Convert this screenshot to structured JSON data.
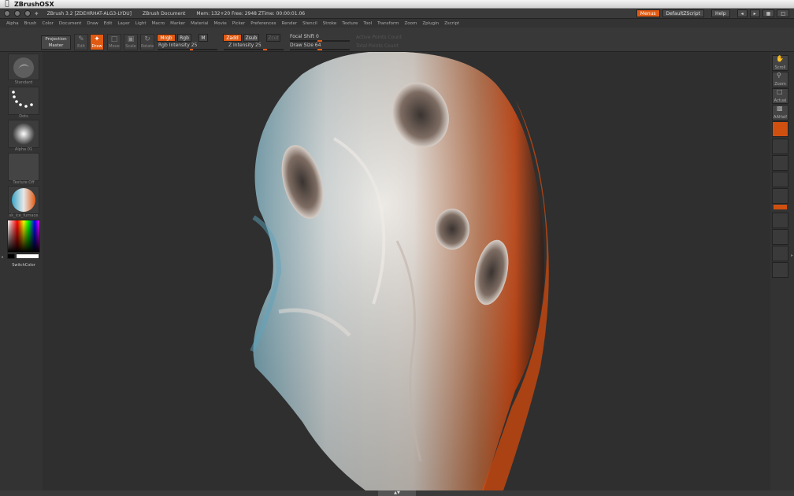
{
  "osx_menubar": {
    "app_name": "ZBrushOSX"
  },
  "titlebar": {
    "app_title": "ZBrush 3.2 [ZDEHRHAT-ALG3-LYDU]",
    "document": "ZBrush Document",
    "stats": "Mem: 132+20  Free: 2948  ZTime: 00:00:01.06",
    "menus_btn": "Menus",
    "script_btn": "DefaultZScript",
    "help_btn": "Help"
  },
  "menubar": {
    "items": [
      "Alpha",
      "Brush",
      "Color",
      "Document",
      "Draw",
      "Edit",
      "Layer",
      "Light",
      "Macro",
      "Marker",
      "Material",
      "Movie",
      "Picker",
      "Preferences",
      "Render",
      "Stencil",
      "Stroke",
      "Texture",
      "Tool",
      "Transform",
      "Zoom",
      "Zplugin",
      "Zscript"
    ]
  },
  "toolbar": {
    "projection_master": "Projection\nMaster",
    "edit": "Edit",
    "draw": "Draw",
    "move": "Move",
    "scale": "Scale",
    "rotate": "Rotate",
    "mrgb": "Mrgb",
    "rgb": "Rgb",
    "m": "M",
    "zadd": "Zadd",
    "zsub": "Zsub",
    "zcut": "Zcut",
    "rgb_intensity": "Rgb Intensity 25",
    "z_intensity": "Z Intensity 25",
    "focal_shift": "Focal Shift 0",
    "draw_size": "Draw Size 64",
    "active_points": "Active Points Count",
    "total_points": "Total Points Count"
  },
  "left_shelf": {
    "brush_label": "Standard",
    "stroke_label": "Dots",
    "alpha_label": "Alpha 01",
    "texture_label": "Texture Off",
    "material_label": "sk_ice_furnace",
    "switch_color": "SwitchColor"
  },
  "right_shelf": {
    "scroll": "Scroll",
    "zoom": "Zoom",
    "actual": "Actual",
    "aahalf": "AAHalf"
  },
  "colors": {
    "accent": "#e05a12",
    "bg": "#2f2f2f",
    "panel": "#383838"
  }
}
